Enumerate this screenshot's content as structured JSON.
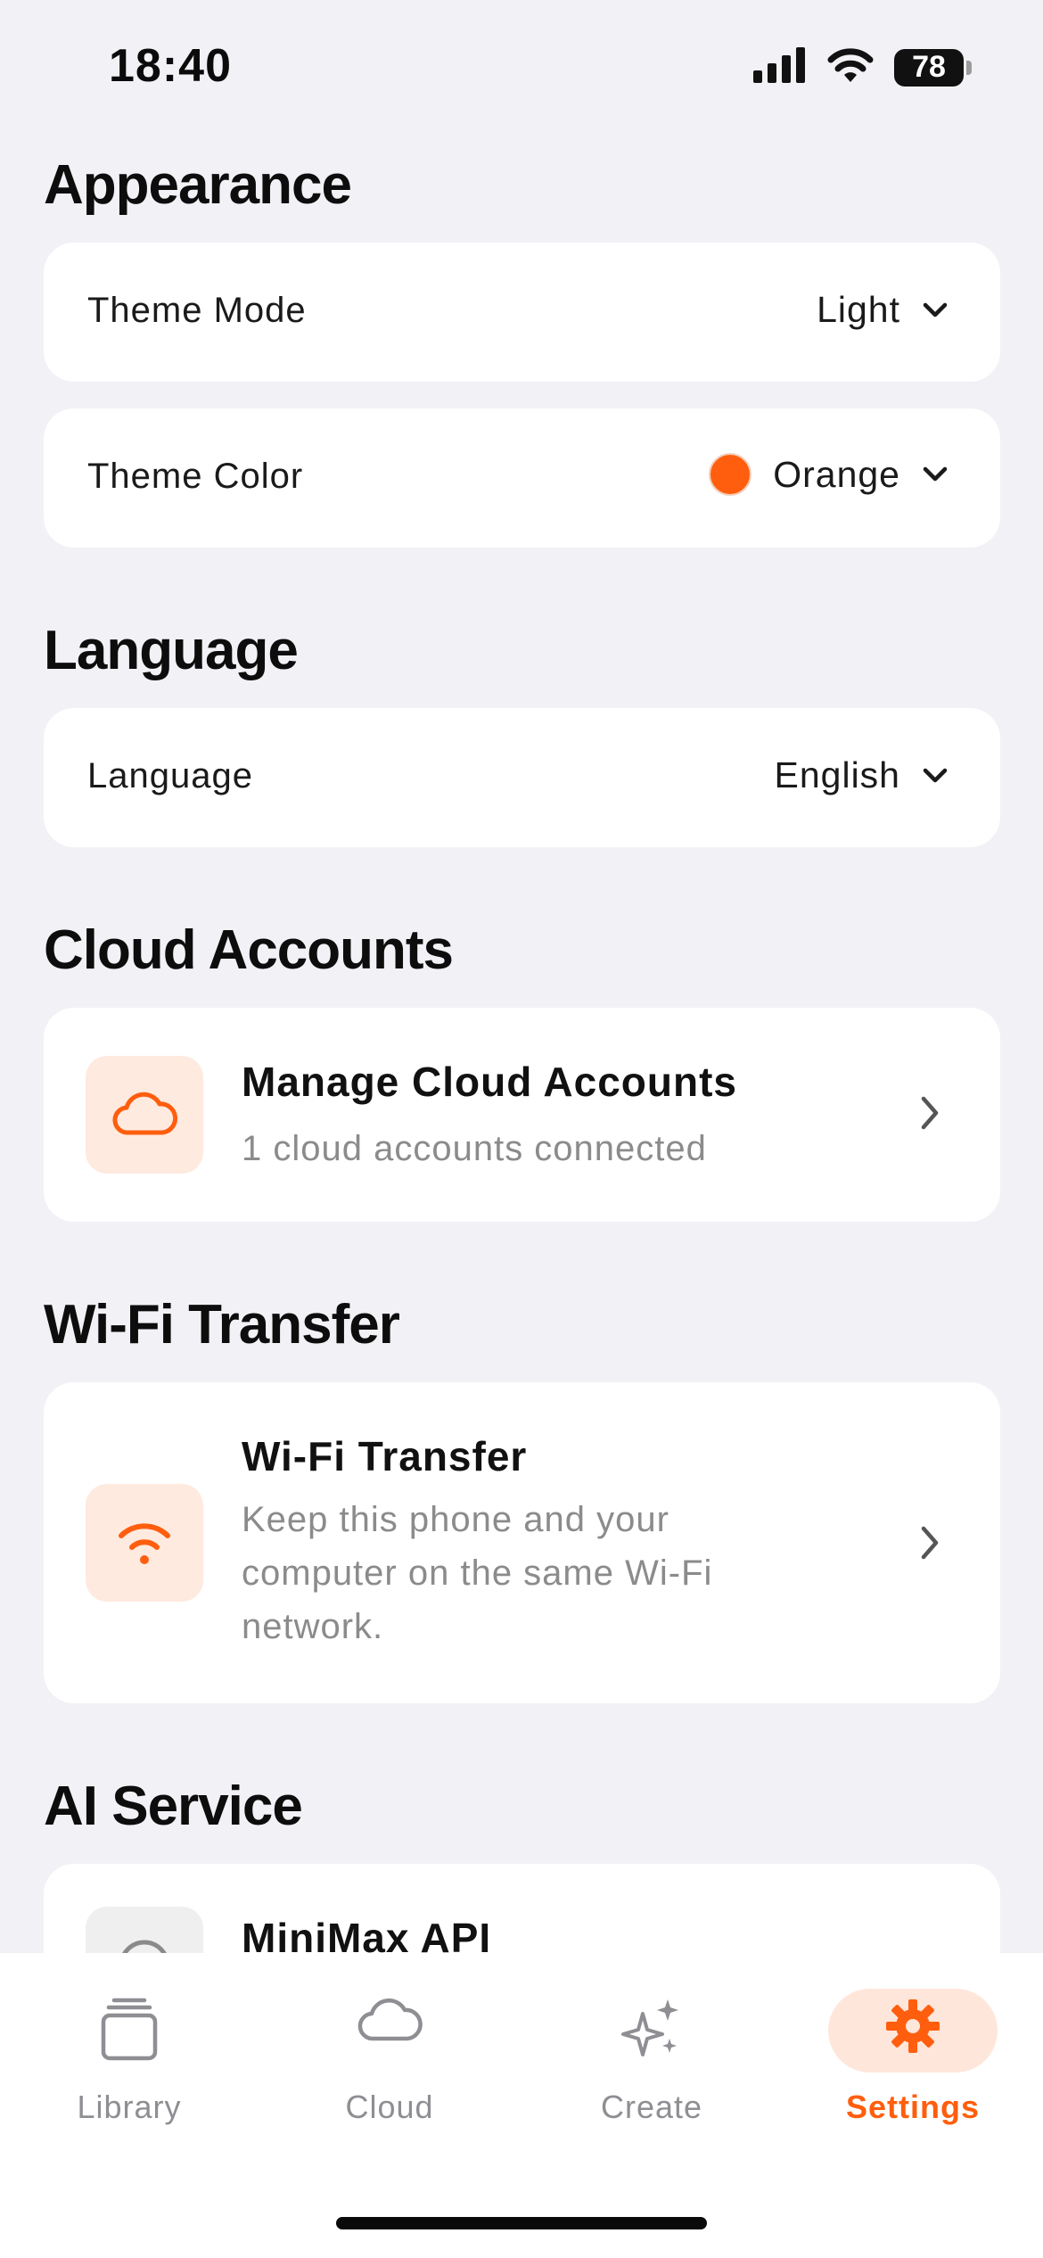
{
  "status_bar": {
    "time": "18:40",
    "battery": "78",
    "icons": [
      "signal-icon",
      "wifi-icon",
      "battery-icon"
    ]
  },
  "colors": {
    "accent": "#FF5E0E",
    "accent_soft": "#FFEAE0",
    "background": "#F2F1F6",
    "card": "#FFFFFF",
    "secondary_text": "#8B8B8B"
  },
  "sections": {
    "appearance": {
      "title": "Appearance",
      "theme_mode": {
        "label": "Theme Mode",
        "value": "Light"
      },
      "theme_color": {
        "label": "Theme Color",
        "value": "Orange",
        "swatch": "#FF5E0E"
      }
    },
    "language": {
      "title": "Language",
      "language": {
        "label": "Language",
        "value": "English"
      }
    },
    "cloud_accounts": {
      "title": "Cloud Accounts",
      "manage": {
        "title": "Manage Cloud Accounts",
        "subtitle": "1 cloud accounts connected",
        "icon": "cloud-icon"
      }
    },
    "wifi_transfer": {
      "title": "Wi-Fi Transfer",
      "item": {
        "title": "Wi-Fi Transfer",
        "subtitle": "Keep this phone and your computer on the same Wi-Fi network.",
        "icon": "wifi-icon"
      }
    },
    "ai_service": {
      "title": "AI Service",
      "item": {
        "title": "MiniMax API",
        "icon": "ai-service-icon"
      }
    }
  },
  "tab_bar": {
    "tabs": [
      {
        "label": "Library",
        "icon": "library-icon",
        "active": false
      },
      {
        "label": "Cloud",
        "icon": "cloud-icon",
        "active": false
      },
      {
        "label": "Create",
        "icon": "sparkles-icon",
        "active": false
      },
      {
        "label": "Settings",
        "icon": "gear-icon",
        "active": true
      }
    ]
  }
}
